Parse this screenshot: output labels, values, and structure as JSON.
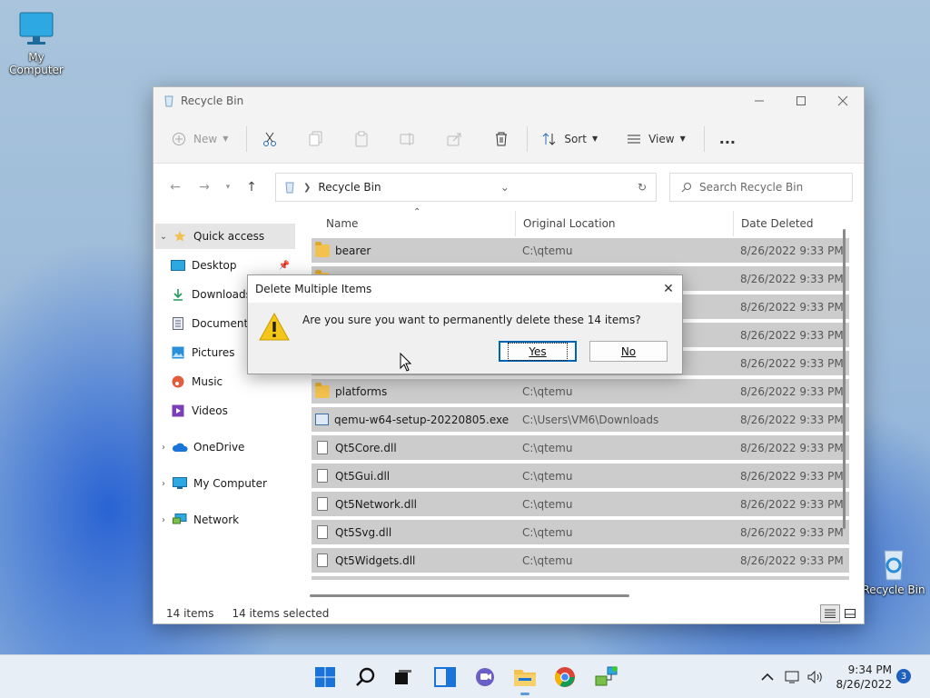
{
  "desktop": {
    "icons": [
      {
        "label": "My Computer",
        "icon": "monitor-icon"
      },
      {
        "label": "Recycle Bin",
        "icon": "recycle-bin-icon"
      }
    ]
  },
  "window": {
    "title": "Recycle Bin",
    "toolbar": {
      "new_label": "New",
      "sort_label": "Sort",
      "view_label": "View",
      "more_label": "..."
    },
    "address": {
      "crumb": "Recycle Bin",
      "search_placeholder": "Search Recycle Bin"
    },
    "nav": {
      "quick_access": "Quick access",
      "desktop": "Desktop",
      "downloads": "Downloads",
      "documents": "Documents",
      "pictures": "Pictures",
      "music": "Music",
      "videos": "Videos",
      "onedrive": "OneDrive",
      "my_computer": "My Computer",
      "network": "Network"
    },
    "columns": {
      "name": "Name",
      "location": "Original Location",
      "date": "Date Deleted"
    },
    "rows": [
      {
        "name": "bearer",
        "location": "C:\\qtemu",
        "date": "8/26/2022 9:33 PM",
        "type": "folder"
      },
      {
        "name": "",
        "location": "",
        "date": "8/26/2022 9:33 PM",
        "type": "folder"
      },
      {
        "name": "",
        "location": "",
        "date": "8/26/2022 9:33 PM",
        "type": "folder"
      },
      {
        "name": "",
        "location": "",
        "date": "8/26/2022 9:33 PM",
        "type": "folder"
      },
      {
        "name": "",
        "location": "",
        "date": "8/26/2022 9:33 PM",
        "type": "folder"
      },
      {
        "name": "platforms",
        "location": "C:\\qtemu",
        "date": "8/26/2022 9:33 PM",
        "type": "folder"
      },
      {
        "name": "qemu-w64-setup-20220805.exe",
        "location": "C:\\Users\\VM6\\Downloads",
        "date": "8/26/2022 9:33 PM",
        "type": "exe"
      },
      {
        "name": "Qt5Core.dll",
        "location": "C:\\qtemu",
        "date": "8/26/2022 9:33 PM",
        "type": "dll"
      },
      {
        "name": "Qt5Gui.dll",
        "location": "C:\\qtemu",
        "date": "8/26/2022 9:33 PM",
        "type": "dll"
      },
      {
        "name": "Qt5Network.dll",
        "location": "C:\\qtemu",
        "date": "8/26/2022 9:33 PM",
        "type": "dll"
      },
      {
        "name": "Qt5Svg.dll",
        "location": "C:\\qtemu",
        "date": "8/26/2022 9:33 PM",
        "type": "dll"
      },
      {
        "name": "Qt5Widgets.dll",
        "location": "C:\\qtemu",
        "date": "8/26/2022 9:33 PM",
        "type": "dll"
      }
    ],
    "status": {
      "count": "14 items",
      "selected": "14 items selected"
    }
  },
  "dialog": {
    "title": "Delete Multiple Items",
    "message": "Are you sure you want to permanently delete these 14 items?",
    "yes_label": "Yes",
    "no_label": "No",
    "close_label": "✕"
  },
  "taskbar": {
    "time": "9:34 PM",
    "date": "8/26/2022",
    "notifications": "3"
  },
  "colors": {
    "accent": "#0063b1",
    "selection": "#cccccc"
  }
}
